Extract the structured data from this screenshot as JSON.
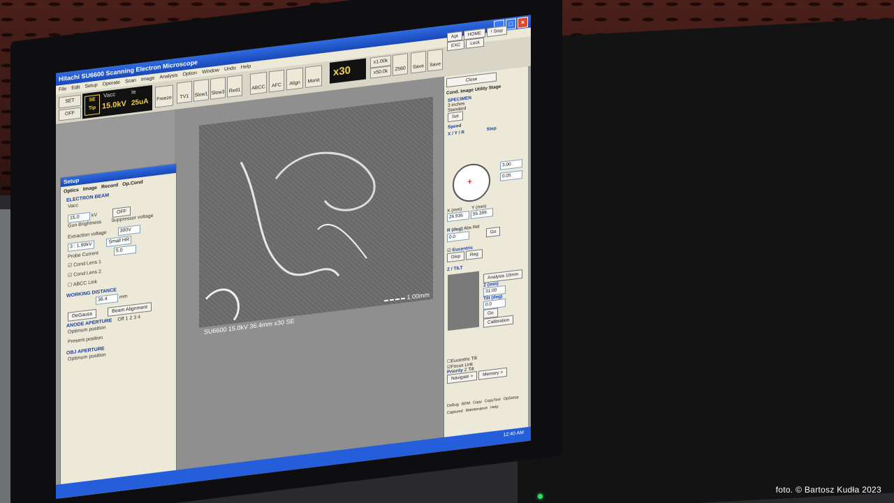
{
  "app": {
    "title": "Hitachi SU6600 Scanning Electron Microscope",
    "menus": [
      "File",
      "Edit",
      "Setup",
      "Operate",
      "Scan",
      "Image",
      "Analysis",
      "Option",
      "Window",
      "Undo",
      "Help"
    ]
  },
  "toolbar": {
    "set_label": "SET",
    "off_label": "OFF",
    "se_tip": "SE Tip",
    "vacc_label": "Vacc",
    "ie_label": "Ie",
    "vacc_value": "15.0kV",
    "ie_value": "25uA",
    "freeze": "Freeze",
    "tv1": "TV1",
    "slow1": "Slow1",
    "slow3": "Slow3",
    "red1": "Red1",
    "abcc": "ABCC",
    "afc": "AFC",
    "align": "Align",
    "monit": "Monit",
    "magnification": "x30",
    "mag_hi": "x1.00k",
    "mag_lo": "x50.0k",
    "res": "2560",
    "save1": "Save",
    "save2": "Save"
  },
  "image": {
    "caption": "SU6600 15.0kV 36.4mm x30 SE",
    "scale": "1.00mm"
  },
  "setup": {
    "title": "Setup",
    "tabs": [
      "Optics",
      "Image",
      "Record",
      "Op.Cond"
    ],
    "electron_beam": "ELECTRON BEAM",
    "vacc": "Vacc",
    "vacc_value": "15.0",
    "kv": "kV",
    "off_button": "OFF",
    "gun_brightness": "Gun Brightness",
    "suppressor": "Suppressor voltage",
    "extraction": "Extraction voltage",
    "supp_value": "300V",
    "extr_value": "3 : 1.90kV",
    "small_hr": "Small HR",
    "probe_current": "Probe Current",
    "probe_value": "5.0",
    "cond1": "Cond Lens 1",
    "cond2": "Cond Lens 2",
    "abcc_link": "ABCC Link",
    "working_distance": "WORKING DISTANCE",
    "wd_value": "36.4",
    "mm": "mm",
    "degauss": "DeGauss",
    "beam_alignment": "Beam Alignment",
    "anode": "ANODE APERTURE",
    "optimum1": "Optimum position",
    "present": "Present position",
    "obj": "OBJ APERTURE",
    "optimum2": "Optimum position",
    "ap_off": "Off",
    "ap_nums": [
      "1",
      "2",
      "3",
      "4"
    ]
  },
  "stage": {
    "apt": "Apt",
    "home": "HOME",
    "stop": "! Stop",
    "exc": "EXC",
    "lock": "Lock",
    "close": "Close",
    "tabs": [
      "Cond.",
      "Image",
      "Utility",
      "Stage"
    ],
    "specimen": "SPECIMEN",
    "size": "3 inches",
    "standard": "Standard",
    "set": "Set",
    "speed": "Speed",
    "xyr": "X / Y / R",
    "step": "Step",
    "step1": "3.00",
    "step2": "0.05",
    "x_label": "X (mm)",
    "y_label": "Y (mm)",
    "x_value": "26.936",
    "y_value": "55.399",
    "r_label": "R (deg)",
    "r_value": "0.0",
    "abs": "Abs",
    "rel": "Rel",
    "go": "Go",
    "eucentric": "Eucentric",
    "disp": "Disp",
    "reg": "Reg",
    "ztilt": "Z / TILT",
    "analysis": "Analysis 10mm",
    "z_label": "Z (mm)",
    "z_value": "31.00",
    "tilt_label": "Tilt (deg)",
    "tilt_value": "0.0",
    "go2": "Go",
    "calibration": "Calibration",
    "euc_tilt": "Eucentric Tilt",
    "focus_link": "Focus Link",
    "priority": "Priority",
    "pz": "Z",
    "pt": "Tilt",
    "navigate": "Navigate >",
    "memory": "Memory >",
    "icons": [
      "DeBug",
      "BDM",
      "Copy",
      "CopyText",
      "OpSetup",
      "Captured",
      "Maintenance",
      "Help"
    ]
  },
  "taskbar": {
    "time": "12:40 AM"
  },
  "credit": "foto. © Bartosz Kudła 2023"
}
